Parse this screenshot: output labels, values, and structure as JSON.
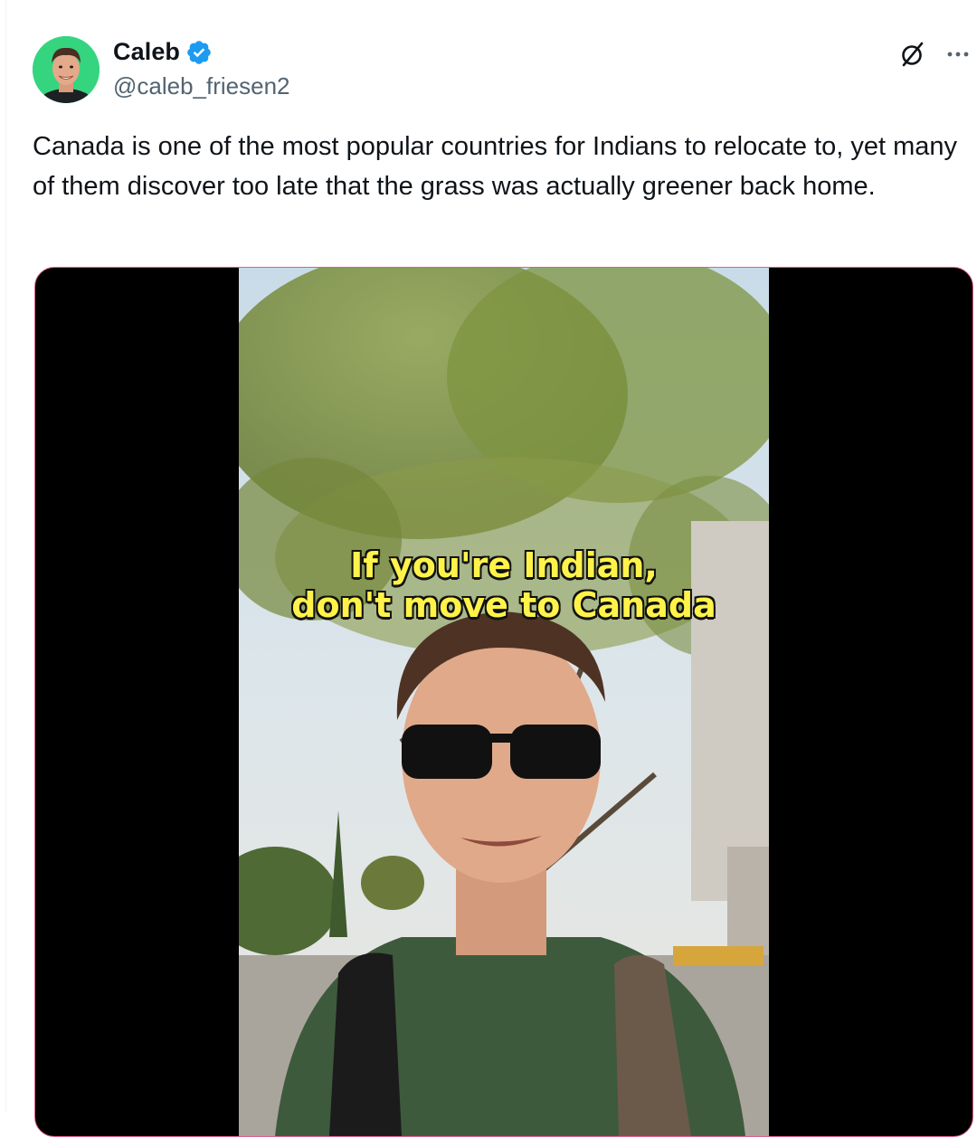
{
  "author": {
    "display_name": "Caleb",
    "handle": "@caleb_friesen2",
    "verified": true
  },
  "actions": {
    "grok_icon": "grok-icon",
    "more_icon": "more-dots-icon"
  },
  "tweet": {
    "text": "Canada is one of the most popular countries for Indians to relocate to, yet many of them discover too late that the grass was actually greener back home."
  },
  "media": {
    "type": "video",
    "caption_line1": "If you're Indian,",
    "caption_line2": "don't move to Canada"
  },
  "colors": {
    "verified_blue": "#1d9bf0",
    "text_primary": "#0f1419",
    "text_secondary": "#536471",
    "caption_yellow": "#fff34a"
  }
}
